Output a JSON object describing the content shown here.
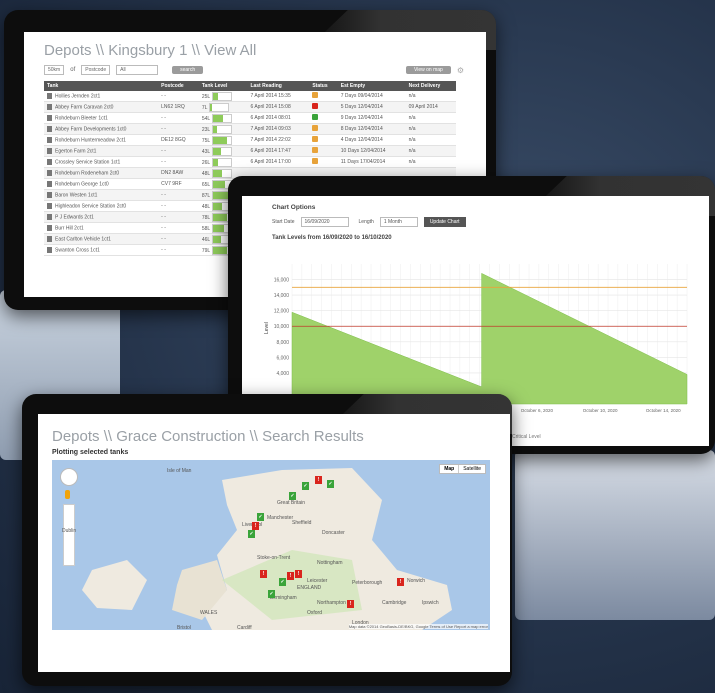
{
  "tablet1": {
    "title": "Depots \\\\ Kingsbury 1 \\\\ View All",
    "controls": {
      "show": "50km",
      "of": "of",
      "postcode": "Postcode",
      "all": "All",
      "search": "search",
      "map_button": "View on map"
    },
    "headers": [
      "Tank",
      "Postcode",
      "Tank Level",
      "Last Reading",
      "Status",
      "Est Empty",
      "Next Delivery"
    ],
    "rows": [
      {
        "tank": "Hollies Jernden 2ct1",
        "postcode": "- -",
        "level": "25L",
        "fill": 0.25,
        "reading": "7 April 2014  15:35",
        "status": "orange",
        "empty": "7 Days",
        "next": "09/04/2014",
        "delivery": "n/a"
      },
      {
        "tank": "Abbey Farm Caravan 2ct0",
        "postcode": "LN62 1RQ",
        "level": "7L",
        "fill": 0.07,
        "reading": "6 April 2014  15:08",
        "status": "red",
        "empty": "5 Days",
        "next": "12/04/2014",
        "delivery": "09 April 2014"
      },
      {
        "tank": "Rohdeburn Bleeter 1ct1",
        "postcode": "- -",
        "level": "54L",
        "fill": 0.54,
        "reading": "6 April 2014  08:01",
        "status": "green",
        "empty": "9 Days",
        "next": "12/04/2014",
        "delivery": "n/a"
      },
      {
        "tank": "Abbey Farm Developments 1ct0",
        "postcode": "- -",
        "level": "23L",
        "fill": 0.23,
        "reading": "7 April 2014  09:03",
        "status": "orange",
        "empty": "8 Days",
        "next": "12/04/2014",
        "delivery": "n/a"
      },
      {
        "tank": "Rohdeburn Huntermeadow 2ct1",
        "postcode": "DE12 8GQ",
        "level": "75L",
        "fill": 0.75,
        "reading": "7 April 2014  22:02",
        "status": "orange",
        "empty": "4 Days",
        "next": "12/04/2014",
        "delivery": "n/a"
      },
      {
        "tank": "Egerton Farm 2ct1",
        "postcode": "- -",
        "level": "43L",
        "fill": 0.43,
        "reading": "6 April 2014  17:47",
        "status": "orange",
        "empty": "10 Days",
        "next": "12/04/2014",
        "delivery": "n/a"
      },
      {
        "tank": "Crossley Service Station 1ct1",
        "postcode": "- -",
        "level": "26L",
        "fill": 0.26,
        "reading": "6 April 2014  17:00",
        "status": "orange",
        "empty": "11 Days",
        "next": "17/04/2014",
        "delivery": "n/a"
      },
      {
        "tank": "Rohdeburn Rodeneham 2ct0",
        "postcode": "DN2 8AW",
        "level": "48L",
        "fill": 0.48,
        "reading": "",
        "status": "",
        "empty": "",
        "next": "",
        "delivery": ""
      },
      {
        "tank": "Rohdeburn George 1ct0",
        "postcode": "CV7 9RF",
        "level": "65L",
        "fill": 0.65,
        "reading": "",
        "status": "",
        "empty": "",
        "next": "",
        "delivery": ""
      },
      {
        "tank": "Baron Westen 1ct1",
        "postcode": "- -",
        "level": "87L",
        "fill": 0.87,
        "reading": "",
        "status": "",
        "empty": "",
        "next": "",
        "delivery": ""
      },
      {
        "tank": "Highleadon Service Station 2ct0",
        "postcode": "- -",
        "level": "48L",
        "fill": 0.48,
        "reading": "",
        "status": "",
        "empty": "",
        "next": "",
        "delivery": ""
      },
      {
        "tank": "P J Edwards 2ct1",
        "postcode": "- -",
        "level": "78L",
        "fill": 0.78,
        "reading": "",
        "status": "",
        "empty": "",
        "next": "",
        "delivery": ""
      },
      {
        "tank": "Burr Hill 2ct1",
        "postcode": "- -",
        "level": "58L",
        "fill": 0.58,
        "reading": "",
        "status": "",
        "empty": "",
        "next": "",
        "delivery": ""
      },
      {
        "tank": "East Carlton Vehicle 1ct1",
        "postcode": "- -",
        "level": "46L",
        "fill": 0.46,
        "reading": "",
        "status": "",
        "empty": "",
        "next": "",
        "delivery": ""
      },
      {
        "tank": "Swanton Cross 1ct1",
        "postcode": "- -",
        "level": "79L",
        "fill": 0.79,
        "reading": "",
        "status": "",
        "empty": "",
        "next": "",
        "delivery": ""
      }
    ]
  },
  "tablet2": {
    "options_title": "Chart Options",
    "start_label": "Start Date",
    "start_value": "16/09/2020",
    "length_label": "Length",
    "length_value": "1 Month",
    "update_button": "Update Chart",
    "chart_title": "Tank Levels from 16/09/2020 to 16/10/2020",
    "legend_note": "Critical Level"
  },
  "chart_data": {
    "type": "area",
    "title": "Tank Levels from 16/09/2020 to 16/10/2020",
    "ylabel": "Level",
    "ylim": [
      0,
      18000
    ],
    "yticks": [
      "16,000",
      "14,000",
      "12,000",
      "10,000",
      "8,000",
      "6,000",
      "4,000"
    ],
    "xticks": [
      "October 6, 2020",
      "October 10, 2020",
      "October 14, 2020"
    ],
    "x": [
      0,
      0.48,
      0.48,
      1.0
    ],
    "values": [
      11800,
      2200,
      16800,
      3800
    ],
    "thresholds": [
      {
        "value": 15000,
        "color": "#e8a33a"
      },
      {
        "value": 10000,
        "color": "#c0392b"
      }
    ],
    "grid": true
  },
  "tablet3": {
    "title": "Depots \\\\ Grace Construction \\\\ Search Results",
    "subtitle": "Plotting selected tanks",
    "map_types": [
      "Map",
      "Satellite"
    ],
    "labels": [
      "Isle of Man",
      "Dublin",
      "Sheffield",
      "Nottingham",
      "Leicester",
      "Peterborough",
      "Norwich",
      "Cambridge",
      "ENGLAND",
      "WALES",
      "Cardiff",
      "Bristol",
      "Birmingham",
      "Manchester",
      "Liverpool",
      "Ipswich",
      "Oxford",
      "London",
      "Great Britain",
      "Doncaster",
      "Stoke-on-Trent",
      "Northampton"
    ],
    "copyright": "Map data ©2014 GeoBasis-DE/BKG, Google  Terms of Use  Report a map error"
  },
  "colors": {
    "green": "#3aa43a",
    "red": "#d9251d",
    "orange": "#e8a33a",
    "chart_fill": "#9fd26a"
  }
}
